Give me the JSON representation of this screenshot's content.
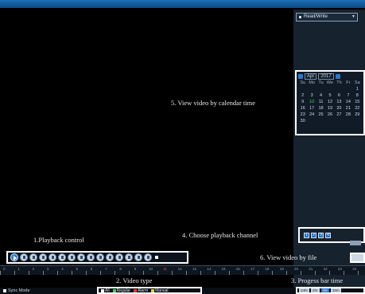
{
  "annotations": {
    "calendar": "5. View video by calendar time",
    "channel": "4. Choose playback channel",
    "playback": "1.Playback control",
    "file": "6. View video by file",
    "type": "2. Video type",
    "progress": "3. Progess bar time"
  },
  "right_panel": {
    "mode_select": "Read/Write"
  },
  "calendar": {
    "month": "Apr",
    "year": "2017",
    "weekdays": [
      "Su",
      "Mo",
      "Tu",
      "We",
      "Th",
      "Fr",
      "Sa"
    ],
    "weeks": [
      [
        "",
        "",
        "",
        "",
        "",
        "",
        "1"
      ],
      [
        "2",
        "3",
        "4",
        "5",
        "6",
        "7",
        "8"
      ],
      [
        "9",
        "10",
        "11",
        "12",
        "13",
        "14",
        "15"
      ],
      [
        "16",
        "17",
        "18",
        "19",
        "20",
        "21",
        "22"
      ],
      [
        "23",
        "24",
        "25",
        "26",
        "27",
        "28",
        "29"
      ],
      [
        "30",
        "",
        "",
        "",
        "",
        "",
        ""
      ]
    ],
    "highlighted_days": [
      "10"
    ]
  },
  "channels": [
    "1",
    "2",
    "3",
    "4"
  ],
  "playback_controls": [
    "play",
    "pause",
    "stop",
    "slow",
    "fast",
    "prev-frame",
    "next-frame",
    "prev-file",
    "next-file",
    "loop",
    "fullscreen",
    "snapshot",
    "clip",
    "audio",
    "zoom"
  ],
  "timeline": {
    "labels": [
      "0",
      "1",
      "2",
      "3",
      "4",
      "5",
      "6",
      "7",
      "8",
      "9",
      "10",
      "11",
      "12",
      "13",
      "14",
      "15",
      "16",
      "17",
      "18",
      "19",
      "20",
      "21",
      "22",
      "23",
      "24"
    ],
    "marker": "11"
  },
  "sync_mode": "Sync Mode",
  "video_types": [
    {
      "label": "All",
      "color": "#ffffff"
    },
    {
      "label": "Regular",
      "color": "#3fce5a"
    },
    {
      "label": "Alarm",
      "color": "#e23c3c"
    },
    {
      "label": "Manual",
      "color": "#e6d23a"
    }
  ],
  "zoom_levels": [
    "24hr",
    "2hr",
    "1hr",
    "30m"
  ],
  "zoom_active": "1hr"
}
